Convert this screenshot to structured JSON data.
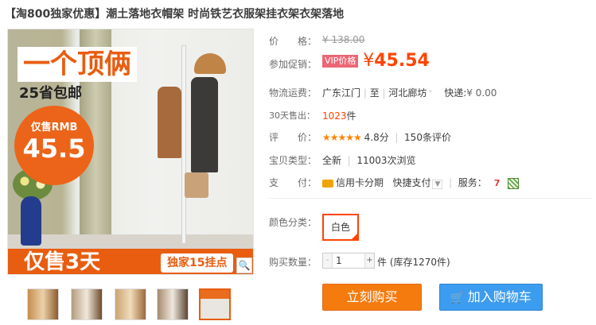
{
  "product_title": "【淘800独家优惠】潮土落地衣帽架 时尚铁艺衣服架挂衣架衣架落地",
  "image_promo": {
    "headline": "一个顶俩",
    "shipping": "25省包邮",
    "price_label": "仅售RMB",
    "price_value": "45.5",
    "days": "仅售3天",
    "hooks": "独家15挂点"
  },
  "zoom_icon": "magnifier-icon",
  "thumbnails_count": 5,
  "info": {
    "price_label": "价　　格：",
    "price_original": "¥ 138.00",
    "promo_label": "参加促销：",
    "vip_badge": "VIP价格",
    "price_yen": "¥",
    "price_current": "45.54",
    "shipping_label": "物流运费：",
    "shipping_from": "广东江门",
    "shipping_sep": "至",
    "shipping_to": "河北廊坊",
    "shipping_express": "快递:",
    "shipping_fee": "¥ 0.00",
    "sold_label": "30天售出：",
    "sold_count": "1023",
    "sold_unit": "件",
    "rating_label": "评　　价：",
    "rating_stars": "★★★★★",
    "rating_score": "4.8分",
    "rating_reviews": "150条评价",
    "type_label": "宝贝类型：",
    "type_value": "全新",
    "type_views": "11003次浏览",
    "pay_label": "支　　付：",
    "pay_credit": "信用卡分期",
    "pay_quick": "快捷支付",
    "service_label": "服务：",
    "color_label": "颜色分类：",
    "color_option": "白色",
    "qty_label": "购买数量：",
    "qty_value": "1",
    "qty_minus": "-",
    "qty_plus": "+",
    "qty_stock": "件 (库存1270件)",
    "buy_now": "立刻购买",
    "add_cart": "加入购物车"
  },
  "colors": {
    "accent": "#ff4400",
    "buy_button": "#f57b0f",
    "cart_button": "#3c9cf0",
    "vip_badge": "#ec6676"
  }
}
